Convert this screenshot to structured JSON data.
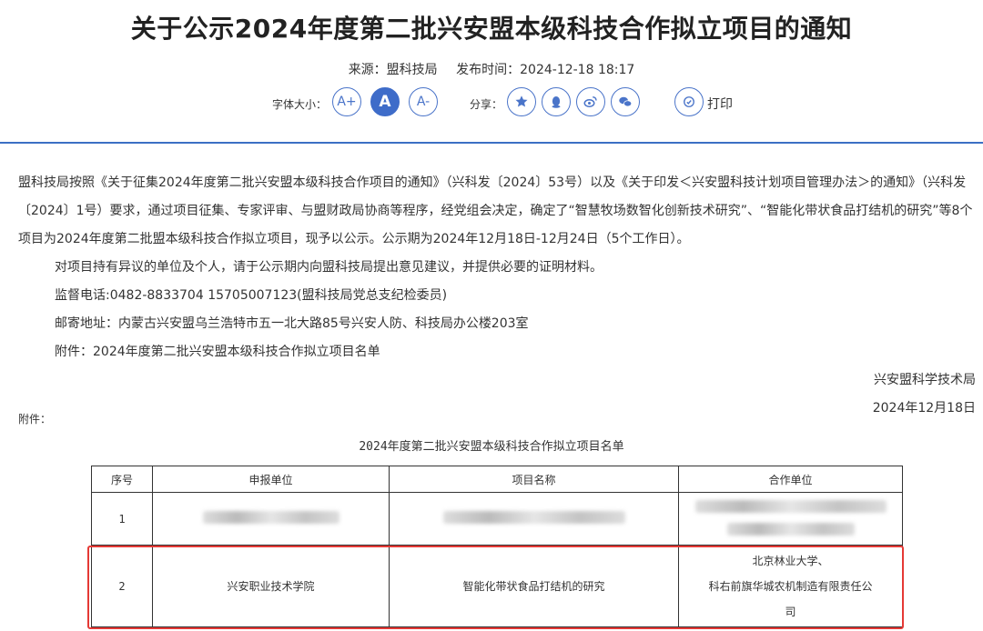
{
  "article": {
    "title": "关于公示2024年度第二批兴安盟本级科技合作拟立项目的通知",
    "source_label": "来源：盟科技局",
    "publish_label": "发布时间：2024-12-18 18:17"
  },
  "toolbar": {
    "font_size_label": "字体大小：",
    "font_increase": "A+",
    "font_normal": "A",
    "font_decrease": "A-",
    "share_label": "分享：",
    "print_label": "打印"
  },
  "body": {
    "para1": "盟科技局按照《关于征集2024年度第二批兴安盟本级科技合作项目的通知》（兴科发〔2024〕53号）以及《关于印发＜兴安盟科技计划项目管理办法＞的通知》（兴科发〔2024〕1号）要求，通过项目征集、专家评审、与盟财政局协商等程序，经党组会决定，确定了“智慧牧场数智化创新技术研究”、“智能化带状食品打结机的研究”等8个项目为2024年度第二批盟本级科技合作拟立项目，现予以公示。公示期为2024年12月18日-12月24日（5个工作日）。",
    "para2": "对项目持有异议的单位及个人，请于公示期内向盟科技局提出意见建议，并提供必要的证明材料。",
    "para3": "监督电话:0482-8833704  15705007123(盟科技局党总支纪检委员)",
    "para4": "邮寄地址：内蒙古兴安盟乌兰浩特市五一北大路85号兴安人防、科技局办公楼203室",
    "para5": "附件：2024年度第二批兴安盟本级科技合作拟立项目名单",
    "signature": "兴安盟科学技术局",
    "date": "2024年12月18日"
  },
  "attachment": {
    "label": "附件：",
    "list_title": "2024年度第二批兴安盟本级科技合作拟立项目名单",
    "columns": [
      "序号",
      "申报单位",
      "项目名称",
      "合作单位"
    ],
    "rows": [
      {
        "no": "1",
        "unit": "",
        "project": "",
        "partner": ""
      },
      {
        "no": "2",
        "unit": "兴安职业技术学院",
        "project": "智能化带状食品打结机的研究",
        "partner_line1": "北京林业大学、",
        "partner_line2": "科右前旗华城农机制造有限责任公",
        "partner_line3": "司"
      }
    ]
  },
  "icons": [
    "qzone-star-icon",
    "qq-penguin-icon",
    "weibo-icon",
    "wechat-icon",
    "print-icon"
  ],
  "colors": {
    "accent": "#3e6cc9",
    "highlight_box": "#e53935"
  }
}
